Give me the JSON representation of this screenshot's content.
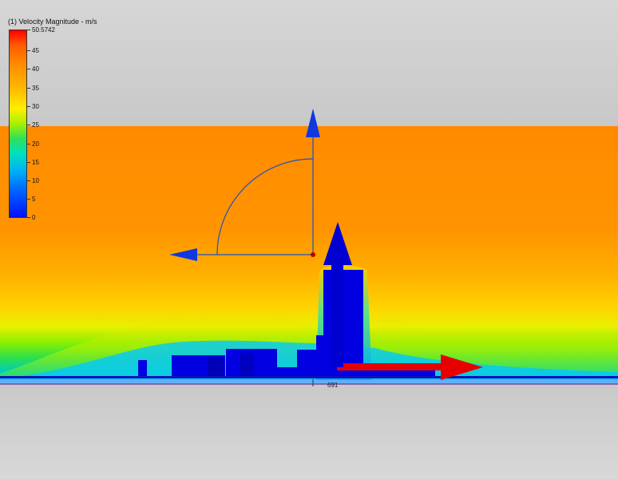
{
  "legend": {
    "title": "(1) Velocity Magnitude - m/s",
    "ticks": [
      "50.5742",
      "45",
      "40",
      "35",
      "30",
      "25",
      "20",
      "15",
      "10",
      "5",
      "0"
    ]
  },
  "node_label": "691",
  "colors": {
    "fast": "#ff8c00",
    "mid": "#ffd800",
    "slow": "#00c8ff",
    "building": "#0000e0",
    "triad_blue": "#1040e0",
    "flow_arrow": "#e60000"
  },
  "icons": {
    "triad": "rotation-triad-icon",
    "flow_direction": "arrow-right-icon",
    "up_vector": "arrow-up-icon"
  }
}
